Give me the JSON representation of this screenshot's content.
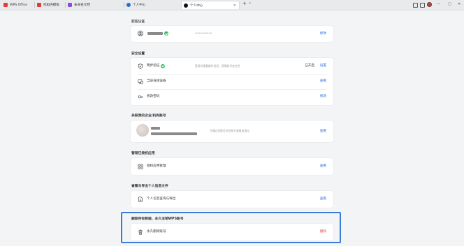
{
  "browser": {
    "tabs": [
      {
        "label": "WPS Office",
        "color": "#e23b32"
      },
      {
        "label": "找稻壳模板",
        "color": "#e23b32"
      },
      {
        "label": "未命名文档",
        "color": "#8a4bd6"
      },
      {
        "label": "个人中心",
        "color": "#2a6bd8"
      },
      {
        "label": "个人中心",
        "color": "#111111"
      }
    ],
    "tab_close": "×",
    "new_tab": "+",
    "tab_menu": "⌄",
    "window_controls": [
      "—",
      "▢",
      "✕"
    ]
  },
  "sections": {
    "realname": {
      "title": "实名认证",
      "account_desc": "8888888888",
      "action": "修改"
    },
    "security": {
      "title": "安全设置",
      "rows": [
        {
          "label": "两步验证",
          "desc": "登录时需要额外验证，提高帐号安全性",
          "status": "已开启",
          "action": "设置"
        },
        {
          "label": "当前在线设备",
          "desc": "",
          "status": "",
          "action": "查看"
        },
        {
          "label": "修改密码",
          "desc": "",
          "status": "",
          "action": "修改"
        }
      ]
    },
    "enterprise": {
      "title": "关联我的企业/机构账号",
      "desc": "可通过切换至对应账号查看或退出",
      "action": "查看"
    },
    "apps": {
      "title": "管理已授权应用",
      "row_label": "授权应用管理",
      "action": "查看"
    },
    "export": {
      "title": "查看与导出个人信息文件",
      "row_label": "个人信息查询与导出",
      "action": "查看"
    },
    "delete": {
      "title": "删除所有数据，永久注销WPS账号",
      "row_label": "永久删除账号",
      "action": "删除"
    }
  },
  "colors": {
    "accent": "#2a6bd8",
    "danger": "#e0453a",
    "success": "#2ebd63",
    "highlight_border": "#3a7bd5"
  }
}
